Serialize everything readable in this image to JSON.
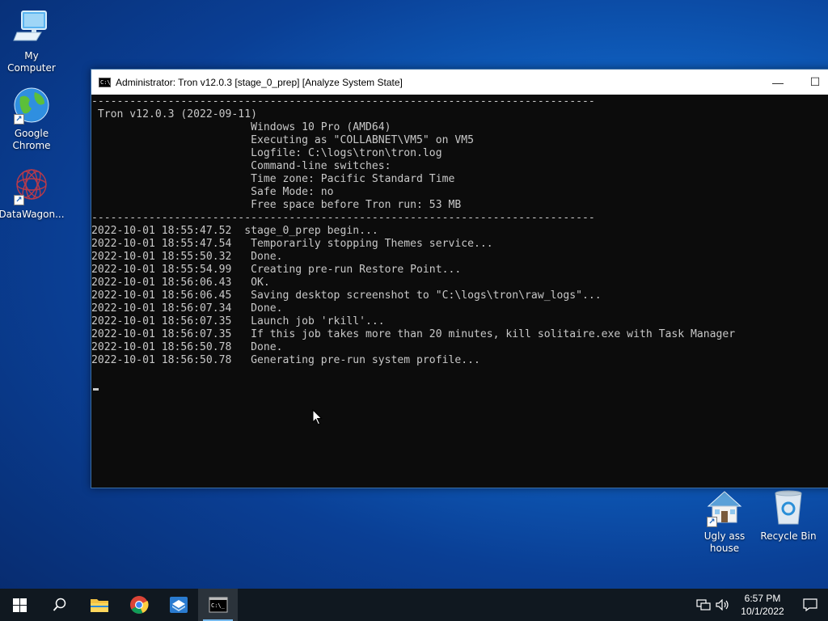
{
  "desktop": {
    "icons": [
      {
        "label": "My Computer"
      },
      {
        "label": "Google Chrome"
      },
      {
        "label": "DataWagon..."
      },
      {
        "label": "Ugly ass house"
      },
      {
        "label": "Recycle Bin"
      }
    ]
  },
  "window": {
    "title": "Administrator:  Tron v12.0.3 [stage_0_prep] [Analyze System State]",
    "icon_text": "C:\\_",
    "minimize_label": "—",
    "maximize_label": "☐",
    "lines": [
      "-------------------------------------------------------------------------------",
      " Tron v12.0.3 (2022-09-11)",
      "                         Windows 10 Pro (AMD64)",
      "                         Executing as \"COLLABNET\\VM5\" on VM5",
      "                         Logfile: C:\\logs\\tron\\tron.log",
      "                         Command-line switches:",
      "                         Time zone: Pacific Standard Time",
      "                         Safe Mode: no",
      "                         Free space before Tron run: 53 MB",
      "-------------------------------------------------------------------------------",
      "2022-10-01 18:55:47.52  stage_0_prep begin...",
      "2022-10-01 18:55:47.54   Temporarily stopping Themes service...",
      "2022-10-01 18:55:50.32   Done.",
      "2022-10-01 18:55:54.99   Creating pre-run Restore Point...",
      "2022-10-01 18:56:06.43   OK.",
      "2022-10-01 18:56:06.45   Saving desktop screenshot to \"C:\\logs\\tron\\raw_logs\"...",
      "2022-10-01 18:56:07.34   Done.",
      "2022-10-01 18:56:07.35   Launch job 'rkill'...",
      "2022-10-01 18:56:07.35   If this job takes more than 20 minutes, kill solitaire.exe with Task Manager",
      "2022-10-01 18:56:50.78   Done.",
      "2022-10-01 18:56:50.78   Generating pre-run system profile..."
    ]
  },
  "taskbar": {
    "items": [
      "start-icon",
      "search-icon",
      "file-explorer-icon",
      "chrome-icon",
      "app-icon",
      "command-prompt-icon"
    ],
    "clock_time": "6:57 PM",
    "clock_date": "10/1/2022"
  },
  "colors": {
    "console_bg": "#0c0c0c",
    "console_fg": "#c8c8c8",
    "taskbar_bg": "#101820",
    "accent": "#76b9ed"
  }
}
